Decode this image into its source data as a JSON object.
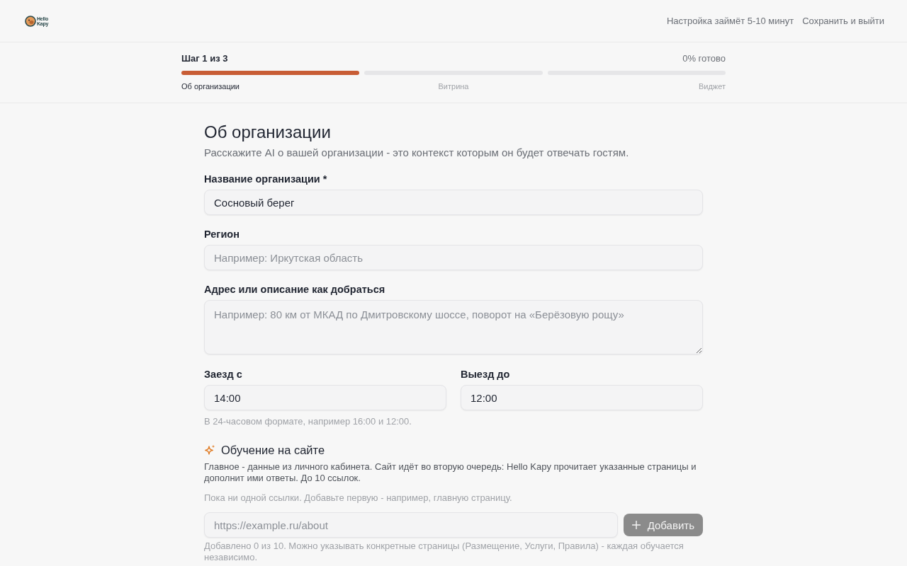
{
  "header": {
    "logo": {
      "line_1": "Hello",
      "line_2": "Kapy"
    },
    "duration_note": "Настройка займёт 5-10 минут",
    "save_exit_link": "Сохранить и выйти"
  },
  "progress": {
    "step_counter": "Шаг 1 из 3",
    "percent_done": "0% готово",
    "steps": [
      {
        "label": "Об организации",
        "selected": true
      },
      {
        "label": "Витрина",
        "selected": false
      },
      {
        "label": "Виджет",
        "selected": false
      }
    ]
  },
  "form": {
    "title": "Об организации",
    "subtitle": "Расскажите AI о вашей организации - это контекст которым он будет отвечать гостям.",
    "fields": [
      {
        "kind": "text",
        "label": "Название организации *",
        "value": "Сосновый берег"
      },
      {
        "kind": "text",
        "label": "Регион",
        "placeholder": "Например: Иркутская область"
      },
      {
        "kind": "textarea",
        "label": "Адрес или описание как добраться",
        "placeholder": "Например: 80 км от МКАД по Дмитровскому шоссе, поворот на «Берёзовую рощу»"
      }
    ],
    "time_fields": [
      {
        "label": "Заезд с",
        "value": "14:00"
      },
      {
        "label": "Выезд до",
        "value": "12:00"
      }
    ],
    "time_hint": "В 24-часовом формате, например 16:00 и 12:00."
  },
  "site_learning": {
    "title": "Обучение на сайте",
    "description": "Главное - данные из личного кабинета. Сайт идёт во вторую очередь: Hello Kapy прочитает указанные страницы и дополнит ими ответы. До 10 ссылок.",
    "empty_note": "Пока ни одной ссылки. Добавьте первую - например, главную страницу.",
    "url_field": {
      "placeholder": "https://example.ru/about"
    },
    "add_button": {
      "label": "Добавить",
      "disabled": true
    },
    "hint": "Добавлено 0 из 10. Можно указывать конкретные страницы (Размещение, Услуги, Правила) - каждая обучается независимо."
  }
}
